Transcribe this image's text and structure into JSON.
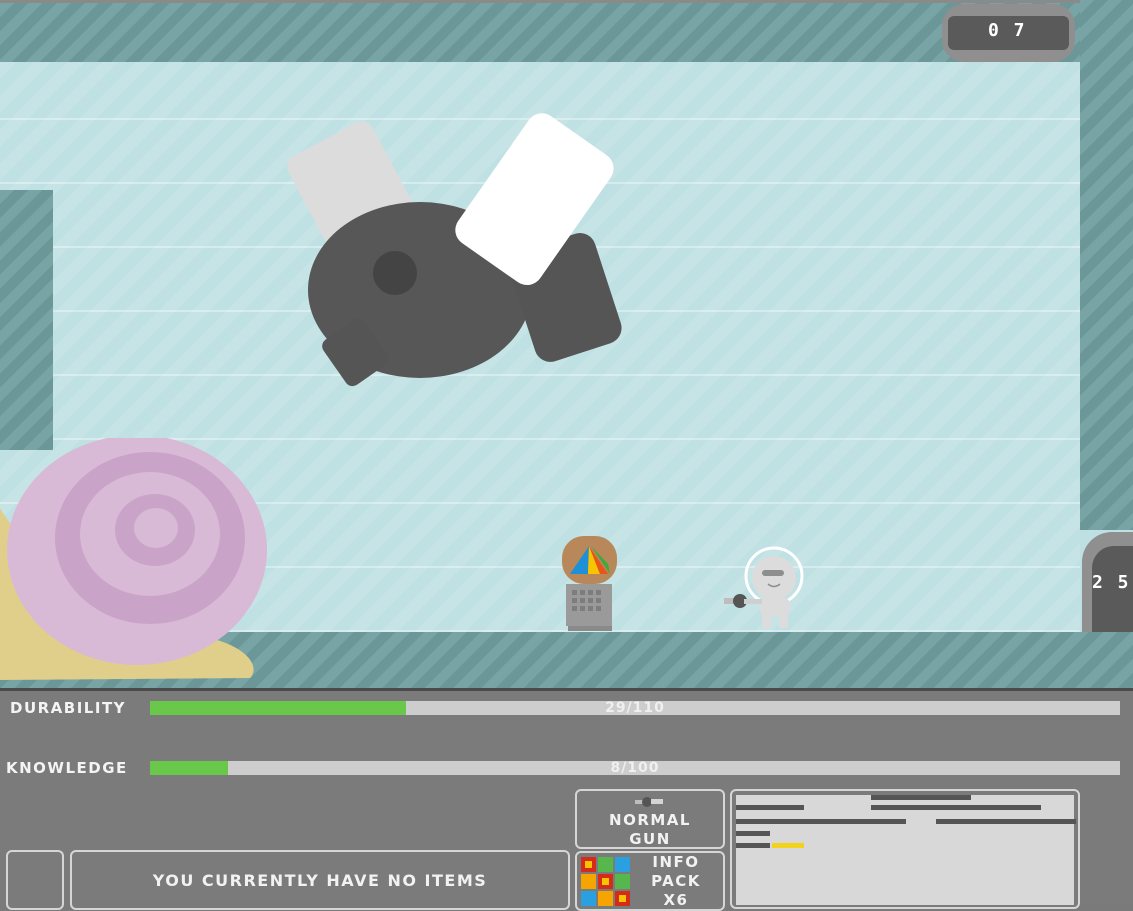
{
  "doors": {
    "top_label": "0 7",
    "right_label": "2 5"
  },
  "hud": {
    "durability": {
      "label": "DURABILITY",
      "text": "29/110",
      "current": 29,
      "max": 110
    },
    "knowledge": {
      "label": "KNOWLEDGE",
      "text": "8/100",
      "current": 8,
      "max": 100
    },
    "items_text": "YOU CURRENTLY HAVE NO ITEMS",
    "weapon": {
      "line1": "NORMAL",
      "line2": "GUN",
      "icon": "gun-icon"
    },
    "info_pack": {
      "line1": "INFO",
      "line2": "PACK",
      "line3": "X6",
      "icon": "colored-grid-icon"
    },
    "minimap": {
      "icon": "minimap",
      "highlight_color": "#f2d21a"
    }
  },
  "colors": {
    "health_fill": "#69c84a",
    "bar_bg": "#cdcdcd",
    "wall": "#6e9c9e",
    "floor_tile": "#bfe1e3"
  }
}
